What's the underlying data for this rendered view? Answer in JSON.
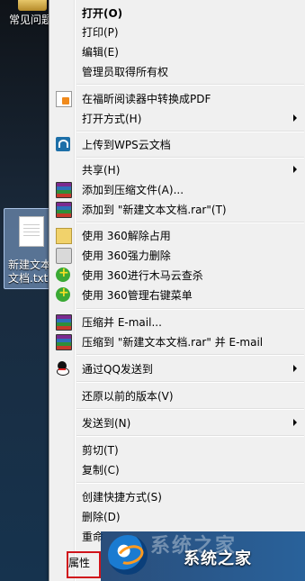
{
  "desktop": {
    "top_icon_label": "常见问题",
    "file_icon_label": "新建文本文档.txt"
  },
  "menu": {
    "items": [
      {
        "label": "打开(O)"
      },
      {
        "label": "打印(P)"
      },
      {
        "label": "编辑(E)"
      },
      {
        "label": "管理员取得所有权"
      },
      {
        "label": "在福昕阅读器中转换成PDF",
        "icon": "pdf-convert-icon"
      },
      {
        "label": "打开方式(H)"
      },
      {
        "label": "上传到WPS云文档",
        "icon": "wps-cloud-icon"
      },
      {
        "label": "共享(H)"
      },
      {
        "label": "添加到压缩文件(A)...",
        "icon": "winrar-icon"
      },
      {
        "label": "添加到 \"新建文本文档.rar\"(T)",
        "icon": "winrar-icon"
      },
      {
        "label": "使用 360解除占用",
        "icon": "360-unlock-icon"
      },
      {
        "label": "使用 360强力删除",
        "icon": "360-shred-icon"
      },
      {
        "label": "使用 360进行木马云查杀",
        "icon": "360-scan-icon"
      },
      {
        "label": "使用 360管理右键菜单",
        "icon": "360-menu-icon"
      },
      {
        "label": "压缩并 E-mail...",
        "icon": "winrar-icon"
      },
      {
        "label": "压缩到 \"新建文本文档.rar\" 并 E-mail",
        "icon": "winrar-icon"
      },
      {
        "label": "通过QQ发送到",
        "icon": "qq-icon"
      },
      {
        "label": "还原以前的版本(V)"
      },
      {
        "label": "发送到(N)"
      },
      {
        "label": "剪切(T)"
      },
      {
        "label": "复制(C)"
      },
      {
        "label": "创建快捷方式(S)"
      },
      {
        "label": "删除(D)"
      },
      {
        "label": "重命"
      },
      {
        "label": "属性"
      }
    ]
  },
  "watermark": {
    "text": "系统之家",
    "faint_text": "系统之家"
  }
}
